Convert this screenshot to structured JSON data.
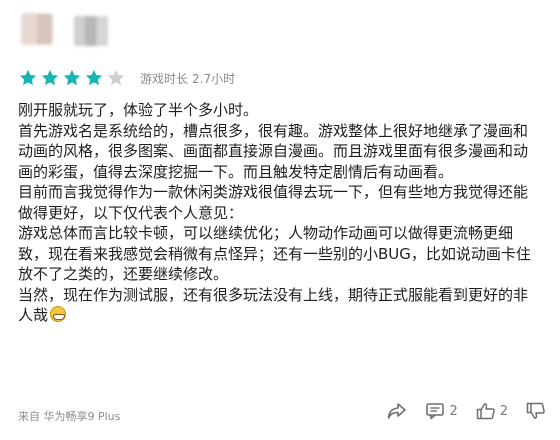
{
  "user": {
    "avatar_icon": "blurred-avatar",
    "name_icon": "blurred-username"
  },
  "rating": {
    "stars_filled": 4,
    "stars_total": 5,
    "filled_color": "#19b4b4",
    "empty_color": "#cfcfcf"
  },
  "playtime": {
    "label": "游戏时长",
    "value": "2.7小时"
  },
  "review": {
    "paragraphs": [
      "刚开服就玩了，体验了半个多小时。",
      "首先游戏名是系统给的，槽点很多，很有趣。游戏整体上很好地继承了漫画和动画的风格，很多图案、画面都直接源自漫画。而且游戏里面有很多漫画和动画的彩蛋，值得去深度挖掘一下。而且触发特定剧情后有动画看。",
      "目前而言我觉得作为一款休闲类游戏很值得去玩一下，但有些地方我觉得还能做得更好，以下仅代表个人意见：",
      "游戏总体而言比较卡顿，可以继续优化；人物动作动画可以做得更流畅更细致，现在看来我感觉会稍微有点怪异；还有一些别的小BUG，比如说动画卡住放不了之类的，还要继续修改。",
      "当然，现在作为测试服，还有很多玩法没有上线，期待正式服能看到更好的非人哉"
    ],
    "trailing_emoji": "grin-emoji"
  },
  "footer": {
    "device": "来自 华为畅享9 Plus",
    "share_icon": "share-icon",
    "comment_count": "2",
    "like_count": "2",
    "dislike_count": ""
  }
}
